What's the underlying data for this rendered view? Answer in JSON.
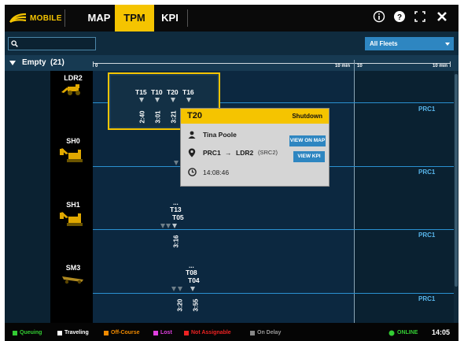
{
  "app": {
    "logo_label": "MOBILE"
  },
  "tabs": [
    {
      "label": "MAP",
      "active": false
    },
    {
      "label": "TPM",
      "active": true
    },
    {
      "label": "KPI",
      "active": false
    }
  ],
  "header_icons": [
    "info-icon",
    "help-icon",
    "fullscreen-icon",
    "close-icon"
  ],
  "search": {
    "placeholder": ""
  },
  "fleet_select": {
    "value": "All Fleets"
  },
  "group": {
    "label": "Empty",
    "count": "(21)"
  },
  "timeline": {
    "start": "0",
    "mid": "10 min",
    "mid_start": "10",
    "end": "10 min"
  },
  "rows": [
    {
      "equipment": "LDR2",
      "route": "PRC1"
    },
    {
      "equipment": "SH0",
      "route": "PRC1"
    },
    {
      "equipment": "SH1",
      "route": "PRC1"
    },
    {
      "equipment": "SM3",
      "route": "PRC1"
    }
  ],
  "queue_box": {
    "trucks": [
      "T15",
      "T10",
      "T20",
      "T16"
    ],
    "times": [
      "2:40",
      "3:01",
      "3:21"
    ]
  },
  "sh1_group": {
    "trucks": [
      "T13",
      "T05"
    ],
    "dots": "...",
    "time": "3:16"
  },
  "sm3_group": {
    "trucks": [
      "T08",
      "T04"
    ],
    "dots": "...",
    "times": [
      "3:20",
      "3:55"
    ]
  },
  "popup": {
    "truck": "T20",
    "status": "Shutdown",
    "operator": "Tina Poole",
    "route_from": "PRC1",
    "route_arrow": "→",
    "route_to": "LDR2",
    "route_src": "(SRC2)",
    "time": "14:08:46",
    "view_map_label": "VIEW ON MAP",
    "view_kpi_label": "VIEW KPI"
  },
  "legend": [
    {
      "label": "Queuing",
      "color": "#33cc33"
    },
    {
      "label": "Traveling",
      "color": "#ffffff"
    },
    {
      "label": "Off-Course",
      "color": "#f08a00"
    },
    {
      "label": "Lost",
      "color": "#e040e0"
    },
    {
      "label": "Not Assignable",
      "color": "#ee2222"
    },
    {
      "label": "On Delay",
      "color": "#888888"
    }
  ],
  "status": {
    "label": "ONLINE",
    "color": "#33cc33",
    "clock": "14:05"
  }
}
